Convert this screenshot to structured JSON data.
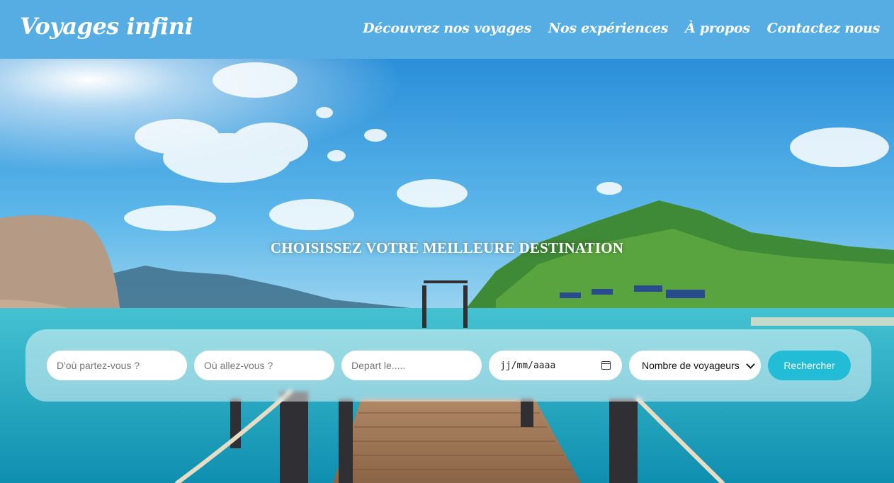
{
  "header": {
    "brand": "Voyages infini",
    "nav": [
      {
        "label": "Découvrez nos voyages"
      },
      {
        "label": "Nos expériences"
      },
      {
        "label": "À propos"
      },
      {
        "label": "Contactez nous"
      }
    ]
  },
  "hero": {
    "headline": "CHOISISSEZ VOTRE MEILLEURE DESTINATION"
  },
  "search": {
    "from_placeholder": "D'où partez-vous ?",
    "to_placeholder": "Où allez-vous ?",
    "depart_placeholder": "Depart le.....",
    "date_value": "jj/mm/aaaa",
    "travelers_selected": "Nombre de voyageurs",
    "submit_label": "Rechercher"
  },
  "colors": {
    "header_bg": "#56ade3",
    "button_bg": "#22bcd6",
    "sky": "#4fa9e0",
    "sea": "#1fa3b8"
  },
  "icons": [
    "calendar-icon",
    "chevron-down-icon"
  ]
}
